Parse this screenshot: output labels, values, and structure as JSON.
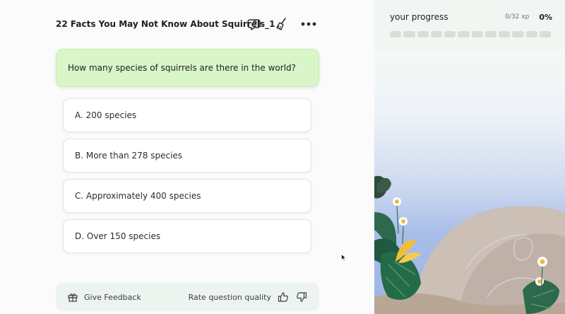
{
  "quiz": {
    "title": "22 Facts You May Not Know About Squirrels_1",
    "question": "How many species of squirrels are there in the world?",
    "options": [
      {
        "label": "A. 200 species"
      },
      {
        "label": "B. More than 278 species"
      },
      {
        "label": "C. Approximately 400 species"
      },
      {
        "label": "D. Over 150 species"
      }
    ]
  },
  "toolbar": {
    "icons": [
      "help-chat-icon",
      "broom-icon",
      "more-icon"
    ]
  },
  "footer": {
    "feedback_label": "Give Feedback",
    "rate_prefix": "Rate",
    "rate_question": "question",
    "rate_suffix": "quality"
  },
  "progress": {
    "label": "your progress",
    "xp": "0/32 xp",
    "percent": "0%",
    "segments_total": 12,
    "segments_filled": 0
  },
  "colors": {
    "question_bg": "#d8f6c7",
    "segment_empty": "#d7ddd9"
  }
}
